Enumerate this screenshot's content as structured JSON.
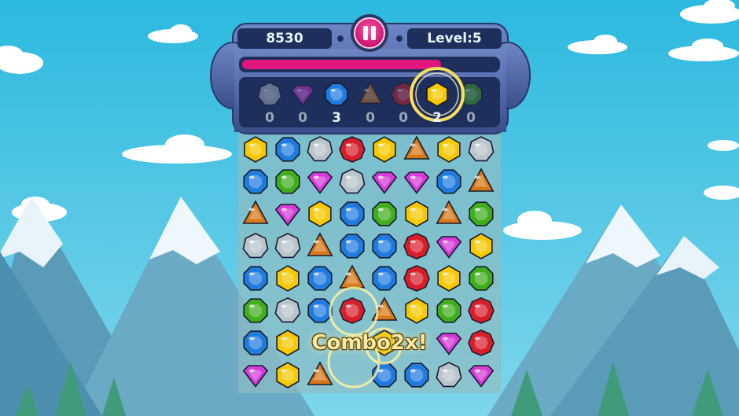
{
  "hud": {
    "score": "8530",
    "level": "Level:5",
    "pause_icon": "pause-icon",
    "progress": 0.78
  },
  "goals": [
    {
      "gem": "silver",
      "count": "0"
    },
    {
      "gem": "purple",
      "count": "0"
    },
    {
      "gem": "blue",
      "count": "3"
    },
    {
      "gem": "orange",
      "count": "0"
    },
    {
      "gem": "red",
      "count": "0"
    },
    {
      "gem": "yellow",
      "count": "2"
    },
    {
      "gem": "green",
      "count": "0"
    }
  ],
  "combo_text": "Combo2x!",
  "board": [
    [
      "yellow",
      "blue",
      "silver",
      "red",
      "yellow",
      "orange",
      "yellow",
      "silver"
    ],
    [
      "blue",
      "green",
      "purple",
      "silver",
      "purple",
      "purple",
      "blue",
      "orange"
    ],
    [
      "orange",
      "purple",
      "yellow",
      "blue",
      "green",
      "yellow",
      "orange",
      "green"
    ],
    [
      "silver",
      "silver",
      "orange",
      "blue",
      "blue",
      "red",
      "purple",
      "yellow"
    ],
    [
      "blue",
      "yellow",
      "blue",
      "orange",
      "blue",
      "red",
      "yellow",
      "green"
    ],
    [
      "green",
      "silver",
      "blue",
      "red",
      "orange",
      "yellow",
      "green",
      "red"
    ],
    [
      "blue",
      "yellow",
      "",
      "",
      "yellow",
      "",
      "purple",
      "red"
    ],
    [
      "purple",
      "yellow",
      "orange",
      "",
      "blue",
      "blue",
      "silver",
      "purple"
    ]
  ],
  "colors": {
    "yellow": "#f5c800",
    "blue": "#1f7be0",
    "silver": "#b9c4cc",
    "red": "#d81e2a",
    "green": "#3fae1c",
    "purple": "#d43bd8",
    "orange": "#d7781a",
    "panel": "#2b3f6e",
    "progress": "#e0157e"
  }
}
